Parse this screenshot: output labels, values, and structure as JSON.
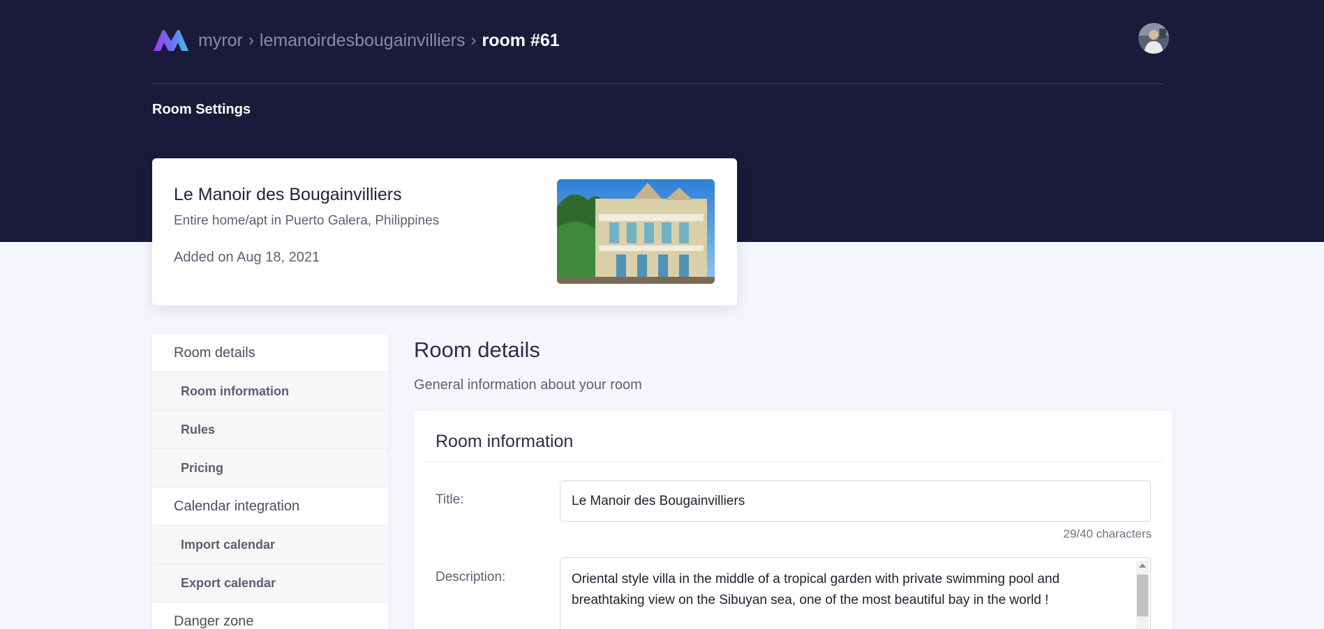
{
  "breadcrumb": {
    "items": [
      "myror",
      "lemanoirdesbougainvilliers"
    ],
    "separator": "›",
    "current": "room #61"
  },
  "header": {
    "section_title": "Room Settings"
  },
  "summary": {
    "title": "Le Manoir des Bougainvilliers",
    "subtitle": "Entire home/apt in Puerto Galera, Philippines",
    "added": "Added on Aug 18, 2021"
  },
  "sidebar": {
    "sections": [
      {
        "label": "Room details",
        "items": [
          {
            "label": "Room information"
          },
          {
            "label": "Rules"
          },
          {
            "label": "Pricing"
          }
        ]
      },
      {
        "label": "Calendar integration",
        "items": [
          {
            "label": "Import calendar"
          },
          {
            "label": "Export calendar"
          }
        ]
      },
      {
        "label": "Danger zone",
        "items": []
      }
    ]
  },
  "main": {
    "title": "Room details",
    "subtitle": "General information about your room",
    "card": {
      "title": "Room information",
      "title_label": "Title:",
      "title_value": "Le Manoir des Bougainvilliers",
      "char_count": "29/40 characters",
      "description_label": "Description:",
      "description_value": "Oriental style villa in the middle of a tropical garden with private swimming pool and breathtaking view on the Sibuyan sea, one of the most beautiful bay in the world !"
    }
  },
  "colors": {
    "hero_bg": "#1a1a3b",
    "page_bg": "#f5f6fb",
    "logo_gradient": [
      "#a23cf0",
      "#3fc7e8"
    ]
  },
  "icons": [
    "logo-icon",
    "avatar"
  ]
}
